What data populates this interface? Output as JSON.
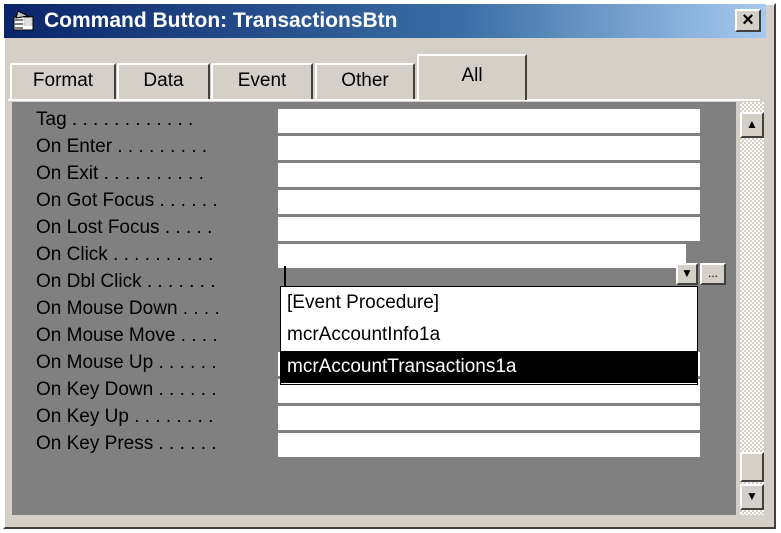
{
  "window": {
    "title": "Command Button: TransactionsBtn",
    "close_glyph": "×"
  },
  "tabs": [
    {
      "label": "Format",
      "active": false
    },
    {
      "label": "Data",
      "active": false
    },
    {
      "label": "Event",
      "active": false
    },
    {
      "label": "Other",
      "active": false
    },
    {
      "label": "All",
      "active": true
    }
  ],
  "properties": [
    {
      "label": "Tag . . . . . . . . . . . .",
      "value": ""
    },
    {
      "label": "On Enter . . . . . . . . .",
      "value": ""
    },
    {
      "label": "On Exit . . . . . . . . . .",
      "value": ""
    },
    {
      "label": "On Got Focus . . . . . .",
      "value": ""
    },
    {
      "label": "On Lost Focus . . . . .",
      "value": ""
    },
    {
      "label": "On Click . . . . . . . . . .",
      "value": ""
    },
    {
      "label": "On Dbl Click . . . . . . .",
      "value": ""
    },
    {
      "label": "On Mouse Down . . . .",
      "value": ""
    },
    {
      "label": "On Mouse Move . . . .",
      "value": ""
    },
    {
      "label": "On Mouse Up . . . . . .",
      "value": ""
    },
    {
      "label": "On Key Down . . . . . .",
      "value": ""
    },
    {
      "label": "On Key Up . . . . . . . .",
      "value": ""
    },
    {
      "label": "On Key Press . . . . . .",
      "value": ""
    }
  ],
  "dropdown": {
    "open_on": "On Click",
    "options": [
      "[Event Procedure]",
      "mcrAccountInfo1a",
      "mcrAccountTransactions1a"
    ],
    "selected": "mcrAccountTransactions1a",
    "arrow_glyph": "▼",
    "builder_glyph": "..."
  },
  "scrollbar": {
    "up_glyph": "▲",
    "down_glyph": "▼"
  },
  "icons": {
    "title": "properties-sheet-icon"
  }
}
